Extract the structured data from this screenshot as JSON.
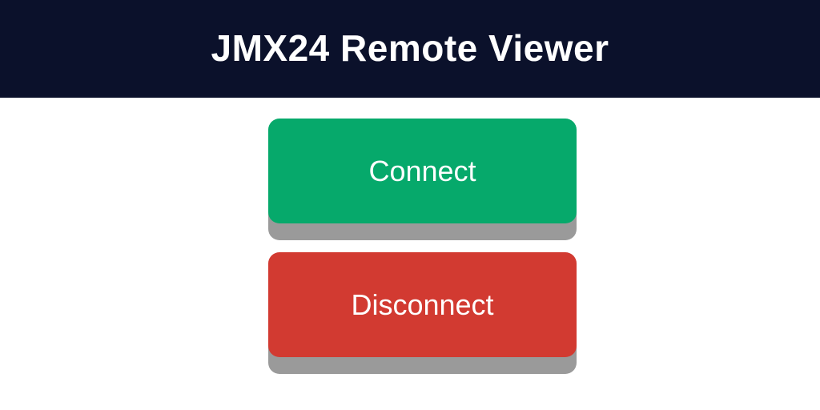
{
  "header": {
    "title": "JMX24 Remote Viewer"
  },
  "buttons": {
    "connect_label": "Connect",
    "disconnect_label": "Disconnect"
  },
  "colors": {
    "header_bg": "#0b112b",
    "connect": "#06a96b",
    "disconnect": "#d23a31",
    "shadow": "#9a9a9a"
  }
}
